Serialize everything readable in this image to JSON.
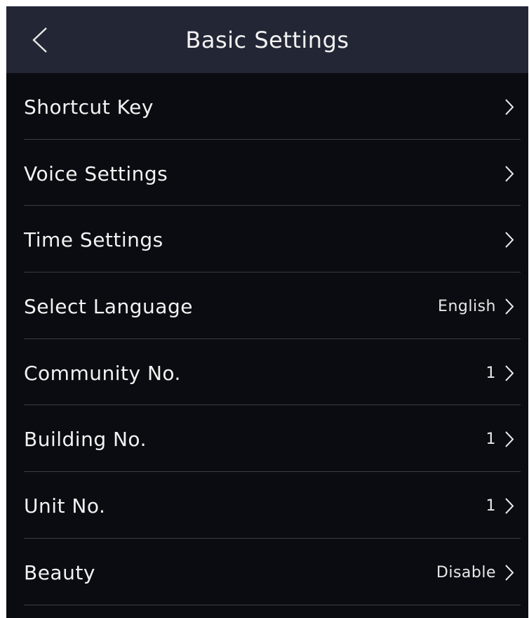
{
  "header": {
    "title": "Basic Settings",
    "back_icon": "chevron-left-icon"
  },
  "colors": {
    "header_background": "#232635",
    "screen_background": "#0b0c11",
    "divider": "#3b3d46",
    "text": "#f2f2f2"
  },
  "settings": {
    "items": [
      {
        "label": "Shortcut Key",
        "value": ""
      },
      {
        "label": "Voice Settings",
        "value": ""
      },
      {
        "label": "Time Settings",
        "value": ""
      },
      {
        "label": "Select Language",
        "value": "English"
      },
      {
        "label": "Community No.",
        "value": "1"
      },
      {
        "label": "Building No.",
        "value": "1"
      },
      {
        "label": "Unit No.",
        "value": "1"
      },
      {
        "label": "Beauty",
        "value": "Disable"
      }
    ],
    "item_icon": "chevron-right-icon"
  }
}
